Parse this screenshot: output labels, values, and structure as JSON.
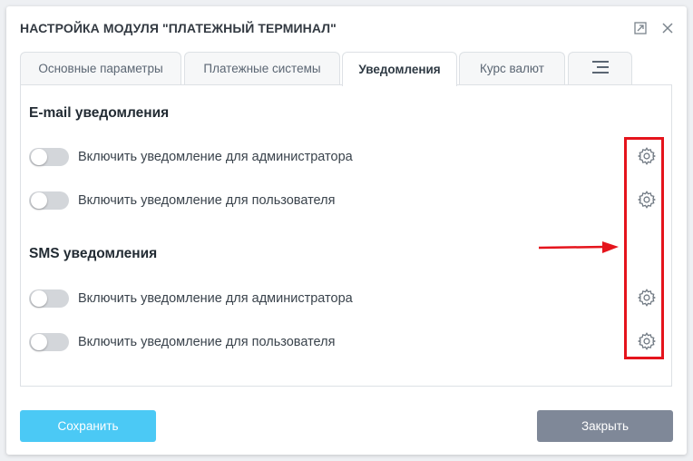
{
  "dialog": {
    "title": "НАСТРОЙКА МОДУЛЯ \"ПЛАТЕЖНЫЙ ТЕРМИНАЛ\""
  },
  "tabs": [
    {
      "label": "Основные параметры",
      "active": false
    },
    {
      "label": "Платежные системы",
      "active": false
    },
    {
      "label": "Уведомления",
      "active": true
    },
    {
      "label": "Курс валют",
      "active": false
    },
    {
      "label": "",
      "icon": "menu-lines-icon",
      "active": false
    }
  ],
  "email_section": {
    "title": "E-mail уведомления",
    "rows": [
      {
        "label": "Включить уведомление для администратора",
        "enabled": false
      },
      {
        "label": "Включить уведомление для пользователя",
        "enabled": false
      }
    ]
  },
  "sms_section": {
    "title": "SMS уведомления",
    "rows": [
      {
        "label": "Включить уведомление для администратора",
        "enabled": false
      },
      {
        "label": "Включить уведомление для пользователя",
        "enabled": false
      }
    ]
  },
  "buttons": {
    "save_label": "Сохранить",
    "close_label": "Закрыть"
  },
  "colors": {
    "accent": "#4bc9f5",
    "secondary_button": "#7f8898",
    "annotation": "#e5141c"
  }
}
